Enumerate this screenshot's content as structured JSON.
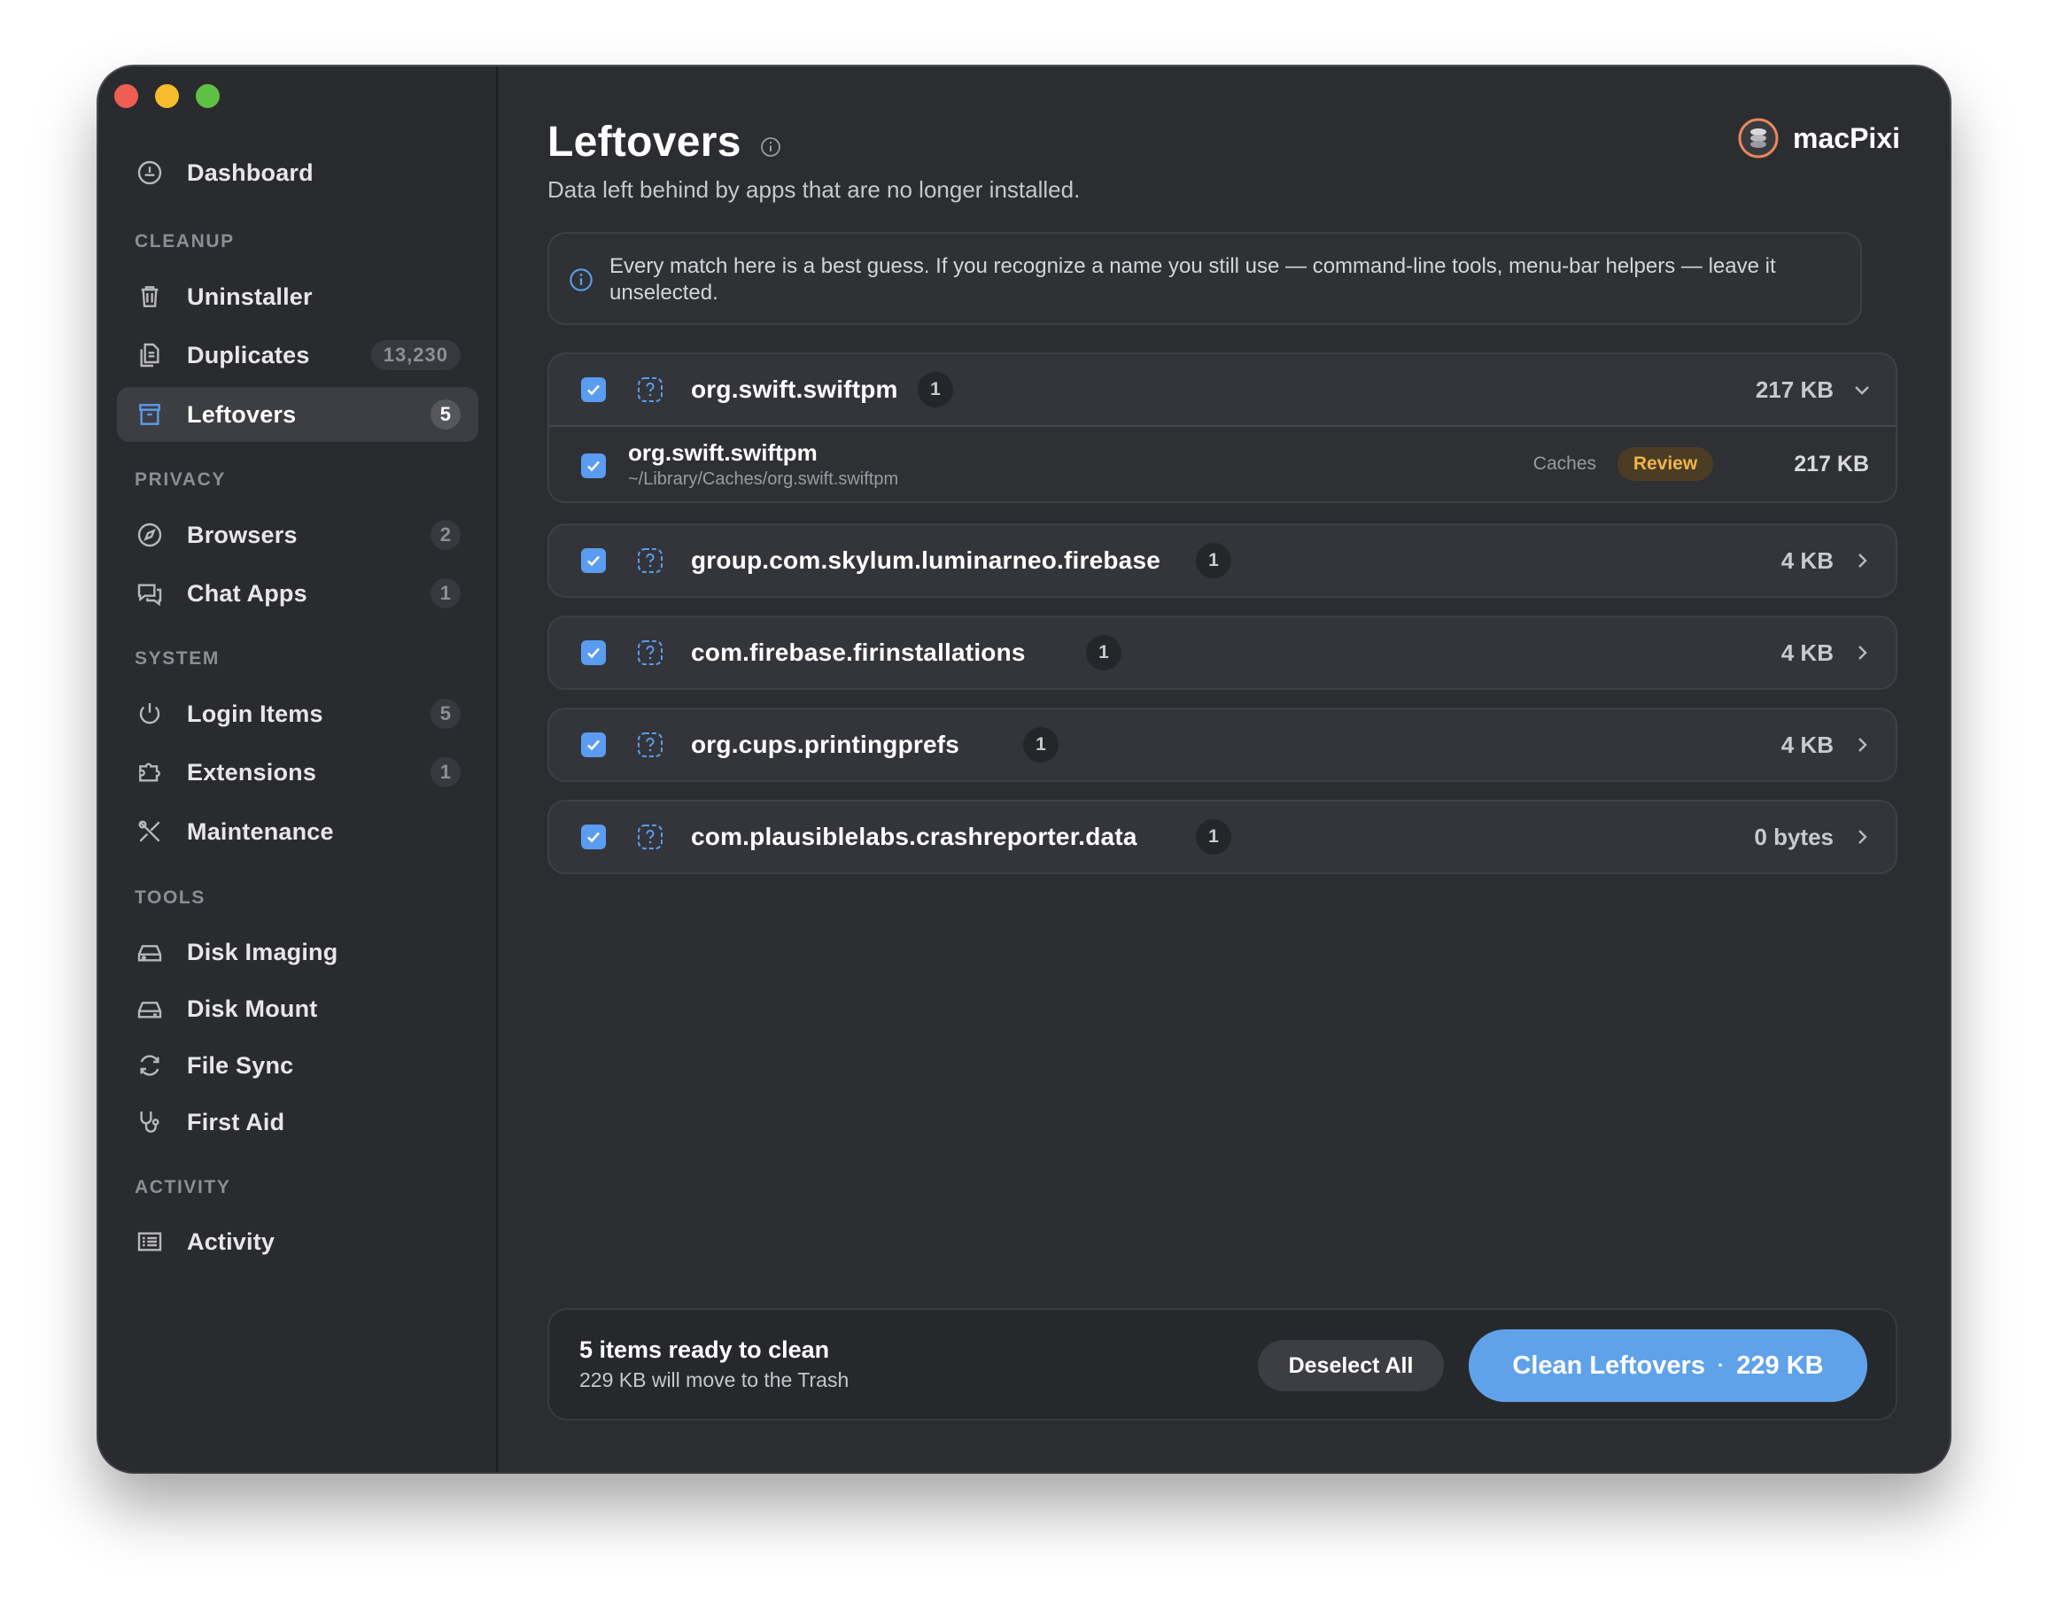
{
  "window": {
    "traffic_lights": [
      "close",
      "minimize",
      "zoom"
    ]
  },
  "sidebar": {
    "top_item": {
      "label": "Dashboard",
      "icon": "gauge-icon"
    },
    "sections": [
      {
        "label": "CLEANUP",
        "items": [
          {
            "label": "Uninstaller",
            "icon": "trash-icon",
            "badge": ""
          },
          {
            "label": "Duplicates",
            "icon": "documents-icon",
            "badge": "13,230"
          },
          {
            "label": "Leftovers",
            "icon": "archive-box-icon",
            "badge": "5",
            "active": true
          }
        ]
      },
      {
        "label": "PRIVACY",
        "items": [
          {
            "label": "Browsers",
            "icon": "compass-icon",
            "badge": "2"
          },
          {
            "label": "Chat Apps",
            "icon": "chat-bubbles-icon",
            "badge": "1"
          }
        ]
      },
      {
        "label": "SYSTEM",
        "items": [
          {
            "label": "Login Items",
            "icon": "power-icon",
            "badge": "5"
          },
          {
            "label": "Extensions",
            "icon": "puzzle-icon",
            "badge": "1"
          },
          {
            "label": "Maintenance",
            "icon": "wrench-screwdriver-icon",
            "badge": ""
          }
        ]
      },
      {
        "label": "TOOLS",
        "items": [
          {
            "label": "Disk Imaging",
            "icon": "disk-drive-icon",
            "badge": ""
          },
          {
            "label": "Disk Mount",
            "icon": "disk-mount-icon",
            "badge": ""
          },
          {
            "label": "File Sync",
            "icon": "sync-arrows-icon",
            "badge": ""
          },
          {
            "label": "First Aid",
            "icon": "stethoscope-icon",
            "badge": ""
          }
        ]
      },
      {
        "label": "ACTIVITY",
        "items": [
          {
            "label": "Activity",
            "icon": "list-icon",
            "badge": ""
          }
        ]
      }
    ]
  },
  "header": {
    "title": "Leftovers",
    "subtitle": "Data left behind by apps that are no longer installed.",
    "brand": "macPixi"
  },
  "notice": {
    "text": "Every match here is a best guess. If you recognize a name you still use — command-line tools, menu-bar helpers — leave it unselected."
  },
  "groups": [
    {
      "name": "org.swift.swiftpm",
      "count": "1",
      "size": "217 KB",
      "checked": true,
      "expanded": true,
      "items": [
        {
          "name": "org.swift.swiftpm",
          "path": "~/Library/Caches/org.swift.swiftpm",
          "kind": "Caches",
          "tag": "Review",
          "size": "217 KB",
          "checked": true
        }
      ]
    },
    {
      "name": "group.com.skylum.luminarneo.firebase",
      "count": "1",
      "size": "4 KB",
      "checked": true,
      "expanded": false
    },
    {
      "name": "com.firebase.firinstallations",
      "count": "1",
      "size": "4 KB",
      "checked": true,
      "expanded": false
    },
    {
      "name": "org.cups.printingprefs",
      "count": "1",
      "size": "4 KB",
      "checked": true,
      "expanded": false
    },
    {
      "name": "com.plausiblelabs.crashreporter.data",
      "count": "1",
      "size": "0 bytes",
      "checked": true,
      "expanded": false
    }
  ],
  "footer": {
    "title": "5 items ready to clean",
    "subtitle": "229 KB will move to the Trash",
    "deselect_label": "Deselect All",
    "clean_label": "Clean Leftovers",
    "clean_separator": "·",
    "clean_size": "229 KB"
  },
  "colors": {
    "accent": "#5a9cf0",
    "clean_button": "#5fa2e9",
    "review_text": "#f0b34a",
    "window_bg": "#2c2d31",
    "sidebar_bg": "#2a2b2f"
  }
}
